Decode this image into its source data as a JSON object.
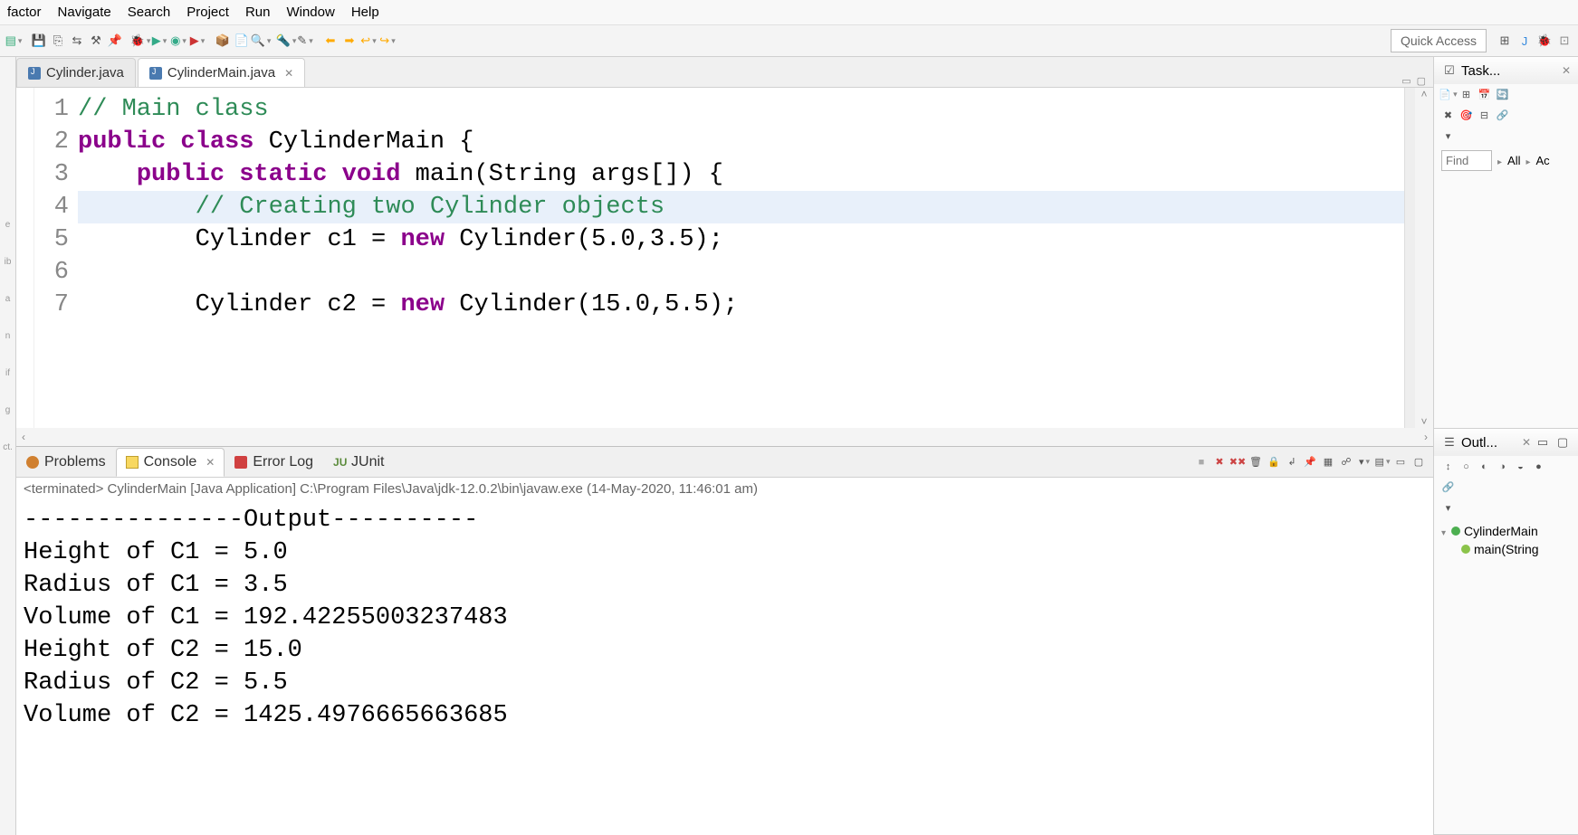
{
  "menu": [
    "factor",
    "Navigate",
    "Search",
    "Project",
    "Run",
    "Window",
    "Help"
  ],
  "quick_access": "Quick Access",
  "editor_tabs": [
    {
      "label": "Cylinder.java",
      "active": false
    },
    {
      "label": "CylinderMain.java",
      "active": true
    }
  ],
  "code_lines": [
    {
      "n": "1",
      "type": "comment",
      "text": "// Main class"
    },
    {
      "n": "2",
      "type": "decl",
      "tokens": [
        "public",
        " ",
        "class",
        " ",
        "CylinderMain",
        " {"
      ]
    },
    {
      "n": "3",
      "type": "decl2",
      "tokens": [
        "    ",
        "public",
        " ",
        "static",
        " ",
        "void",
        " ",
        "main",
        "(",
        "String",
        " ",
        "args",
        "[]) {"
      ]
    },
    {
      "n": "4",
      "type": "comment_hl",
      "text": "        // Creating two Cylinder objects"
    },
    {
      "n": "5",
      "type": "stmt",
      "tokens": [
        "        Cylinder c1 = ",
        "new",
        " Cylinder(5.0,3.5);"
      ]
    },
    {
      "n": "6",
      "type": "blank",
      "text": ""
    },
    {
      "n": "7",
      "type": "stmt",
      "tokens": [
        "        Cylinder c2 = ",
        "new",
        " Cylinder(15.0,5.5);"
      ]
    }
  ],
  "bottom_tabs": [
    "Problems",
    "Console",
    "Error Log",
    "JUnit"
  ],
  "bottom_active": 1,
  "console_status": "<terminated> CylinderMain [Java Application] C:\\Program Files\\Java\\jdk-12.0.2\\bin\\javaw.exe (14-May-2020, 11:46:01 am)",
  "console_lines": [
    "---------------Output----------",
    "Height of C1 = 5.0",
    "Radius of C1 = 3.5",
    "Volume of C1 = 192.42255003237483",
    "Height of C2 = 15.0",
    "Radius of C2 = 5.5",
    "Volume of C2 = 1425.4976665663685"
  ],
  "task_view": {
    "title": "Task...",
    "find_placeholder": "Find",
    "links": [
      "All",
      "Ac"
    ]
  },
  "outline_view": {
    "title": "Outl...",
    "root": "CylinderMain",
    "child": "main(String"
  },
  "left_strip": [
    "e",
    "ib",
    "a",
    "n",
    "if",
    "g",
    "ct."
  ]
}
